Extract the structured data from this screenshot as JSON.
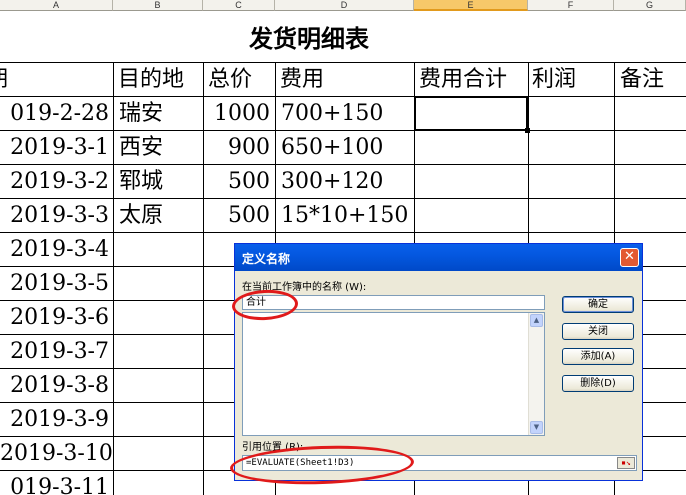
{
  "sheet": {
    "column_headers": [
      "A",
      "B",
      "C",
      "D",
      "E",
      "F",
      "G"
    ],
    "active_column": "E",
    "title": "发货明细表",
    "headers": [
      "期",
      "目的地",
      "总价",
      "费用",
      "费用合计",
      "利润",
      "备注"
    ],
    "rows": [
      {
        "date": "019-2-28",
        "dest": "瑞安",
        "total": "1000",
        "fee": "700+150"
      },
      {
        "date": "2019-3-1",
        "dest": "西安",
        "total": "900",
        "fee": "650+100"
      },
      {
        "date": "2019-3-2",
        "dest": "郓城",
        "total": "500",
        "fee": "300+120"
      },
      {
        "date": "2019-3-3",
        "dest": "太原",
        "total": "500",
        "fee": "15*10+150"
      },
      {
        "date": "2019-3-4"
      },
      {
        "date": "2019-3-5"
      },
      {
        "date": "2019-3-6"
      },
      {
        "date": "2019-3-7"
      },
      {
        "date": "2019-3-8"
      },
      {
        "date": "2019-3-9"
      },
      {
        "date": "2019-3-10"
      },
      {
        "date": "019-3-11"
      }
    ]
  },
  "dialog": {
    "title": "定义名称",
    "close_icon": "close-x",
    "name_label": "在当前工作簿中的名称 (W):",
    "name_value": "合计",
    "refers_label": "引用位置 (R):",
    "refers_value": "=EVALUATE(Sheet1!D3)",
    "buttons": {
      "ok": "确定",
      "close": "关闭",
      "add": "添加(A)",
      "delete": "删除(D)"
    }
  },
  "annotation_color": "#e01a1a"
}
